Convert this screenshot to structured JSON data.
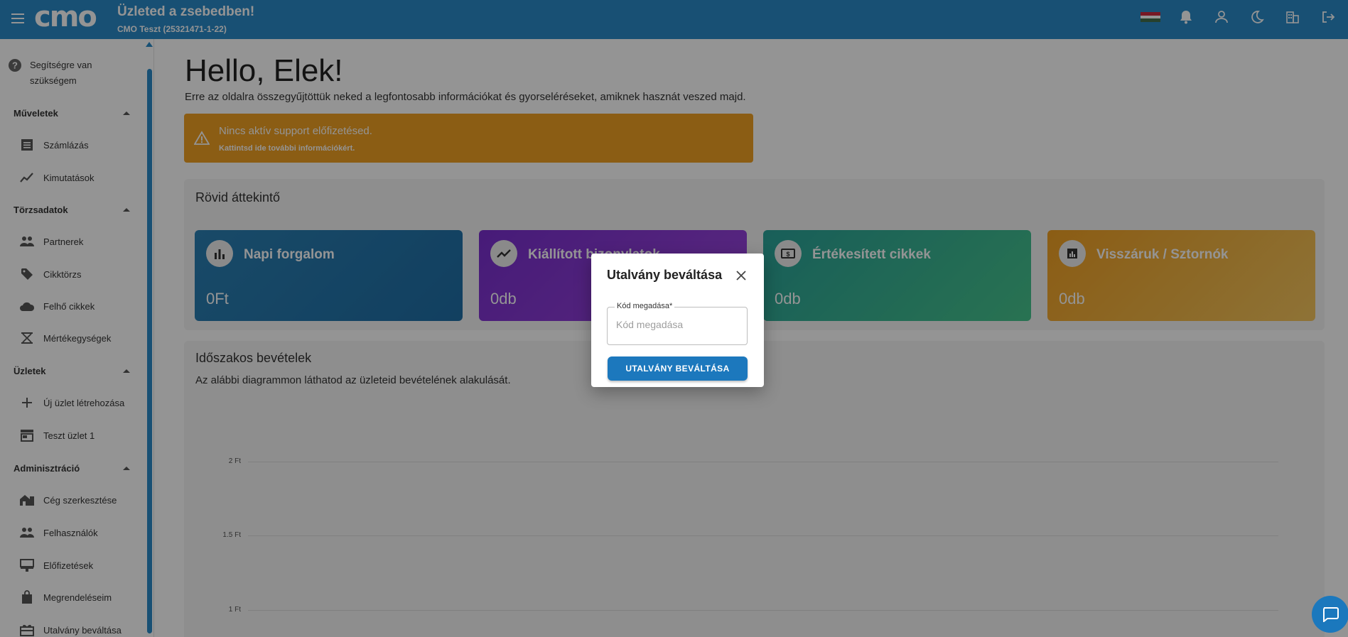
{
  "header": {
    "logo": "cmo",
    "title": "Üzleted a zsebedben!",
    "company": "CMO Teszt (25321471-1-22)"
  },
  "sidebar": {
    "help": "Segítségre van szükségem",
    "sections": [
      {
        "title": "Műveletek",
        "items": [
          {
            "label": "Számlázás",
            "icon": "invoice-icon"
          },
          {
            "label": "Kimutatások",
            "icon": "chart-line-icon"
          }
        ]
      },
      {
        "title": "Törzsadatok",
        "items": [
          {
            "label": "Partnerek",
            "icon": "people-icon"
          },
          {
            "label": "Cikktörzs",
            "icon": "tag-icon"
          },
          {
            "label": "Felhő cikkek",
            "icon": "cloud-icon"
          },
          {
            "label": "Mértékegységek",
            "icon": "scale-icon"
          }
        ]
      },
      {
        "title": "Üzletek",
        "items": [
          {
            "label": "Új üzlet létrehozása",
            "icon": "plus-icon"
          },
          {
            "label": "Teszt üzlet 1",
            "icon": "store-icon"
          }
        ]
      },
      {
        "title": "Adminisztráció",
        "items": [
          {
            "label": "Cég szerkesztése",
            "icon": "company-icon"
          },
          {
            "label": "Felhasználók",
            "icon": "people-icon"
          },
          {
            "label": "Előfizetések",
            "icon": "subscription-icon"
          },
          {
            "label": "Megrendeléseim",
            "icon": "bag-icon"
          },
          {
            "label": "Utalvány beváltása",
            "icon": "gift-icon"
          }
        ]
      }
    ]
  },
  "main": {
    "greeting": "Hello, Elek!",
    "subtitle": "Erre az oldalra összegyűjtöttük neked a legfontosabb információkat és gyorseléréseket, amiknek hasznát veszed majd.",
    "alert": {
      "title": "Nincs aktív support előfizetésed.",
      "subtitle": "Kattintsd ide további információkért."
    },
    "overview": {
      "title": "Rövid áttekintő",
      "cards": [
        {
          "title": "Napi forgalom",
          "value": "0Ft",
          "icon": "bar-chart-icon",
          "color": "#2b80b3"
        },
        {
          "title": "Kiállított bizonylatok",
          "value": "0db",
          "icon": "trend-icon",
          "color": "#8034d0"
        },
        {
          "title": "Értékesített cikkek",
          "value": "0db",
          "icon": "money-icon",
          "color": "#2fa995"
        },
        {
          "title": "Visszáruk / Sztornók",
          "value": "0db",
          "icon": "report-icon",
          "color": "#f0a023"
        }
      ]
    },
    "revenue": {
      "title": "Időszakos bevételek",
      "subtitle": "Az alábbi diagrammon láthatod az üzleteid bevételének alakulását."
    }
  },
  "chart_data": {
    "type": "line",
    "title": "",
    "ylabel": "",
    "yticks": [
      "2 Ft",
      "1.5 Ft",
      "1 Ft"
    ],
    "series": []
  },
  "modal": {
    "title": "Utalvány beváltása",
    "field_label": "Kód megadása*",
    "field_placeholder": "Kód megadása",
    "field_value": "",
    "button": "UTALVÁNY BEVÁLTÁSA"
  },
  "colors": {
    "topbar": "#2a8bc8",
    "primary_button": "#1c78bd",
    "alert": "#f0a023"
  }
}
